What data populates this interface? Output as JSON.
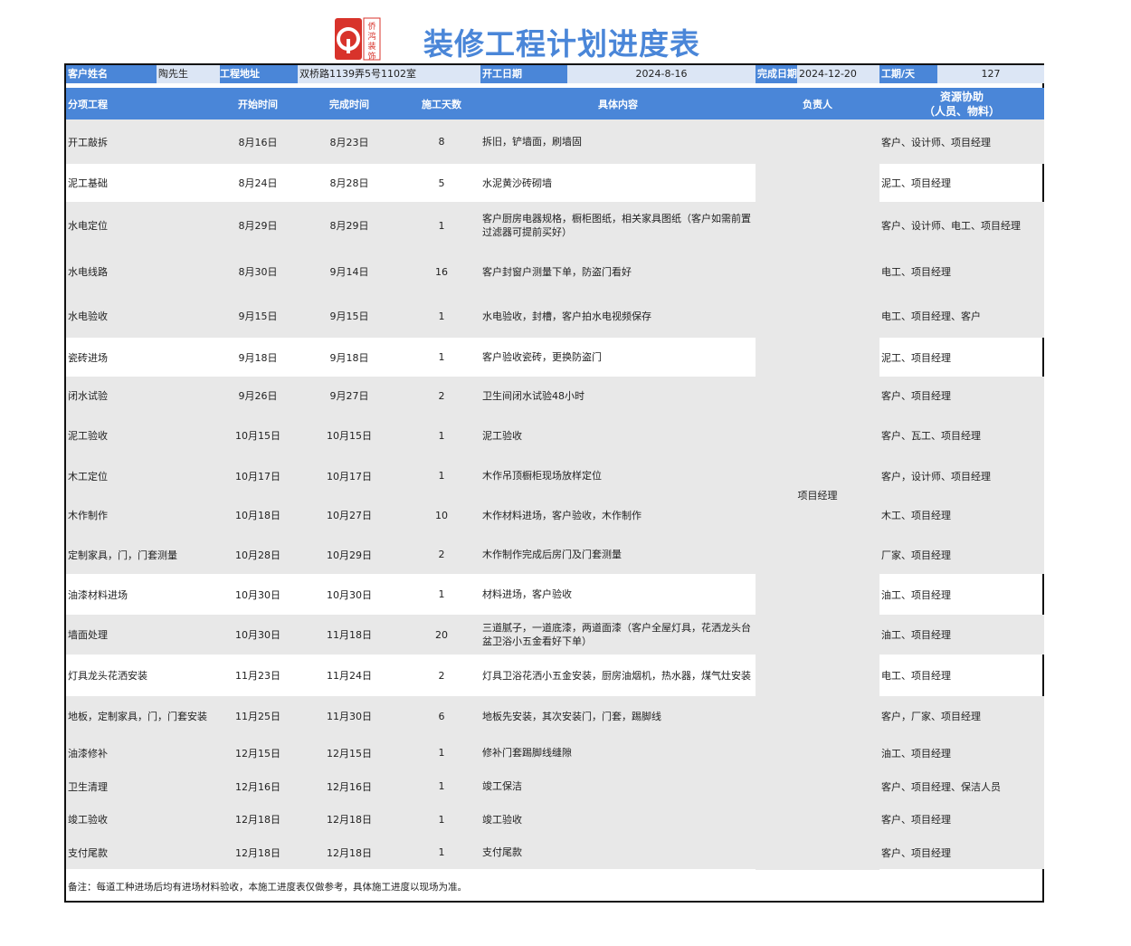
{
  "logo": {
    "text": "侨鸿装饰"
  },
  "title": "装修工程计划进度表",
  "info": {
    "customer_label": "客户姓名",
    "customer_value": "陶先生",
    "address_label": "工程地址",
    "address_value": "双桥路1139弄5号1102室",
    "start_label": "开工日期",
    "start_value": "2024-8-16",
    "end_label": "完成日期",
    "end_value": "2024-12-20",
    "days_label": "工期/天",
    "days_value": "127"
  },
  "headers": {
    "item": "分项工程",
    "start": "开始时间",
    "end": "完成时间",
    "days": "施工天数",
    "content": "具体内容",
    "owner": "负责人",
    "resource_1": "资源协助",
    "resource_2": "（人员、物料）"
  },
  "owner_merged": "项目经理",
  "rows": [
    {
      "item": "开工敲拆",
      "start": "8月16日",
      "end": "8月23日",
      "days": "8",
      "content": "拆旧，铲墙面，刷墙固",
      "resource": "客户、设计师、项目经理"
    },
    {
      "item": "泥工基础",
      "start": "8月24日",
      "end": "8月28日",
      "days": "5",
      "content": "水泥黄沙砖砌墙",
      "resource": "泥工、项目经理"
    },
    {
      "item": "水电定位",
      "start": "8月29日",
      "end": "8月29日",
      "days": "1",
      "content": "客户厨房电器规格，橱柜图纸，相关家具图纸（客户如需前置过滤器可提前买好）",
      "resource": "客户、设计师、电工、项目经理"
    },
    {
      "item": "水电线路",
      "start": "8月30日",
      "end": "9月14日",
      "days": "16",
      "content": "客户封窗户测量下单，防盗门看好",
      "resource": "电工、项目经理"
    },
    {
      "item": "水电验收",
      "start": "9月15日",
      "end": "9月15日",
      "days": "1",
      "content": "水电验收，封槽，客户拍水电视频保存",
      "resource": "电工、项目经理、客户"
    },
    {
      "item": "瓷砖进场",
      "start": "9月18日",
      "end": "9月18日",
      "days": "1",
      "content": "客户验收瓷砖，更换防盗门",
      "resource": "泥工、项目经理"
    },
    {
      "item": "闭水试验",
      "start": "9月26日",
      "end": "9月27日",
      "days": "2",
      "content": "卫生间闭水试验48小时",
      "resource": "客户、项目经理"
    },
    {
      "item": "泥工验收",
      "start": "10月15日",
      "end": "10月15日",
      "days": "1",
      "content": "泥工验收",
      "resource": "客户、瓦工、项目经理"
    },
    {
      "item": "木工定位",
      "start": "10月17日",
      "end": "10月17日",
      "days": "1",
      "content": "木作吊顶橱柜现场放样定位",
      "resource": "客户，设计师、项目经理"
    },
    {
      "item": "木作制作",
      "start": "10月18日",
      "end": "10月27日",
      "days": "10",
      "content": "木作材料进场，客户验收，木作制作",
      "resource": "木工、项目经理"
    },
    {
      "item": "定制家具，门，门套测量",
      "start": "10月28日",
      "end": "10月29日",
      "days": "2",
      "content": "木作制作完成后房门及门套测量",
      "resource": "厂家、项目经理"
    },
    {
      "item": "油漆材料进场",
      "start": "10月30日",
      "end": "10月30日",
      "days": "1",
      "content": "材料进场，客户验收",
      "resource": "油工、项目经理"
    },
    {
      "item": "墙面处理",
      "start": "10月30日",
      "end": "11月18日",
      "days": "20",
      "content": "三道腻子，一道底漆，两道面漆（客户全屋灯具，花洒龙头台盆卫浴小五金看好下单）",
      "resource": "油工、项目经理"
    },
    {
      "item": "灯具龙头花洒安装",
      "start": "11月23日",
      "end": "11月24日",
      "days": "2",
      "content": "灯具卫浴花洒小五金安装，厨房油烟机，热水器，煤气灶安装",
      "resource": "电工、项目经理"
    },
    {
      "item": "地板，定制家具，门，门套安装",
      "start": "11月25日",
      "end": "11月30日",
      "days": "6",
      "content": "地板先安装，其次安装门，门套，踢脚线",
      "resource": "客户，厂家、项目经理"
    },
    {
      "item": "油漆修补",
      "start": "12月15日",
      "end": "12月15日",
      "days": "1",
      "content": "修补门套踢脚线缝隙",
      "resource": "油工、项目经理"
    },
    {
      "item": "卫生清理",
      "start": "12月16日",
      "end": "12月16日",
      "days": "1",
      "content": "竣工保洁",
      "resource": "客户、项目经理、保洁人员"
    },
    {
      "item": "竣工验收",
      "start": "12月18日",
      "end": "12月18日",
      "days": "1",
      "content": "竣工验收",
      "resource": "客户、项目经理"
    },
    {
      "item": "支付尾款",
      "start": "12月18日",
      "end": "12月18日",
      "days": "1",
      "content": "支付尾款",
      "resource": "客户、项目经理"
    }
  ],
  "note": "备注：每道工种进场后均有进场材料验收，本施工进度表仅做参考，具体施工进度以现场为准。",
  "colors": {
    "accent": "#4a86d8",
    "light": "#dce6f5",
    "gray": "#e8e8e8",
    "logo_red": "#d8332b"
  }
}
